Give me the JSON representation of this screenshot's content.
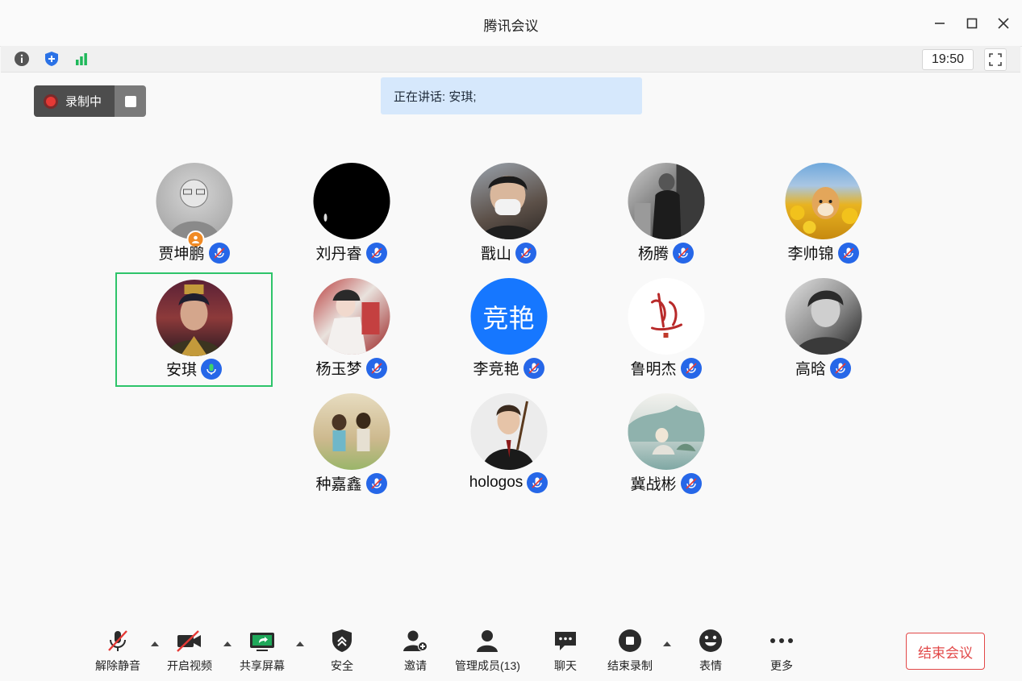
{
  "window": {
    "title": "腾讯会议"
  },
  "toolbar": {
    "clock": "19:50"
  },
  "recording": {
    "label": "录制中"
  },
  "speaking": {
    "text": "正在讲话: 安琪;"
  },
  "participants": [
    {
      "name": "贾坤鹏",
      "host": true
    },
    {
      "name": "刘丹睿"
    },
    {
      "name": "戬山"
    },
    {
      "name": "杨腾"
    },
    {
      "name": "李帅锦"
    },
    {
      "name": "安琪",
      "speaking": true
    },
    {
      "name": "杨玉梦"
    },
    {
      "name": "李竞艳",
      "avatar_text": "竞艳"
    },
    {
      "name": "鲁明杰"
    },
    {
      "name": "高晗"
    },
    {
      "name": "种嘉鑫"
    },
    {
      "name": "hologos"
    },
    {
      "name": "冀战彬"
    }
  ],
  "bottom": {
    "unmute": "解除静音",
    "video": "开启视频",
    "share": "共享屏幕",
    "security": "安全",
    "invite": "邀请",
    "members": "管理成员(13)",
    "chat": "聊天",
    "stop_record": "结束录制",
    "emoji": "表情",
    "more": "更多",
    "end": "结束会议"
  },
  "colors": {
    "accent": "#2667e8",
    "active_border": "#2ec46a",
    "end_red": "#e24848",
    "speaking_bg": "#d6e8fc"
  }
}
